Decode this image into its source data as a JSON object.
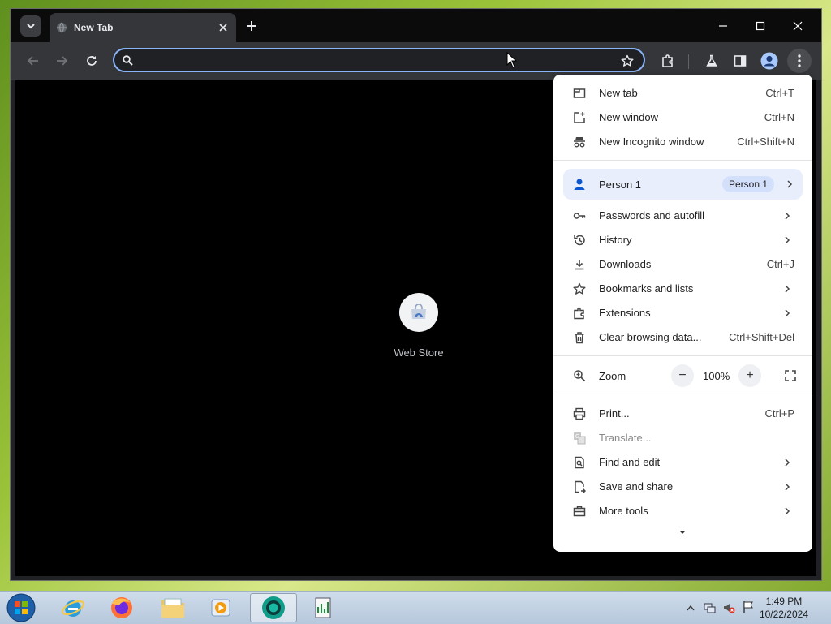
{
  "window": {
    "tab": {
      "title": "New Tab"
    }
  },
  "omnibox": {
    "value": "",
    "placeholder": ""
  },
  "shortcut": {
    "label": "Web Store"
  },
  "menu": {
    "group1": [
      {
        "label": "New tab",
        "shortcut": "Ctrl+T",
        "icon": "new-tab-icon"
      },
      {
        "label": "New window",
        "shortcut": "Ctrl+N",
        "icon": "new-window-icon"
      },
      {
        "label": "New Incognito window",
        "shortcut": "Ctrl+Shift+N",
        "icon": "incognito-icon"
      }
    ],
    "person": {
      "label": "Person 1",
      "badge": "Person 1"
    },
    "group2": [
      {
        "label": "Passwords and autofill",
        "shortcut": "",
        "icon": "key-icon",
        "submenu": true
      },
      {
        "label": "History",
        "shortcut": "",
        "icon": "history-icon",
        "submenu": true
      },
      {
        "label": "Downloads",
        "shortcut": "Ctrl+J",
        "icon": "download-icon",
        "submenu": false
      },
      {
        "label": "Bookmarks and lists",
        "shortcut": "",
        "icon": "star-icon",
        "submenu": true
      },
      {
        "label": "Extensions",
        "shortcut": "",
        "icon": "puzzle-icon",
        "submenu": true
      },
      {
        "label": "Clear browsing data...",
        "shortcut": "Ctrl+Shift+Del",
        "icon": "trash-icon",
        "submenu": false
      }
    ],
    "zoom": {
      "label": "Zoom",
      "value": "100%",
      "minus": "−",
      "plus": "+"
    },
    "group3": [
      {
        "label": "Print...",
        "shortcut": "Ctrl+P",
        "icon": "print-icon",
        "submenu": false,
        "disabled": false
      },
      {
        "label": "Translate...",
        "shortcut": "",
        "icon": "translate-icon",
        "submenu": false,
        "disabled": true
      },
      {
        "label": "Find and edit",
        "shortcut": "",
        "icon": "find-icon",
        "submenu": true,
        "disabled": false
      },
      {
        "label": "Save and share",
        "shortcut": "",
        "icon": "save-share-icon",
        "submenu": true,
        "disabled": false
      },
      {
        "label": "More tools",
        "shortcut": "",
        "icon": "toolbox-icon",
        "submenu": true,
        "disabled": false
      }
    ]
  },
  "taskbar": {
    "clock_time": "1:49 PM",
    "clock_date": "10/22/2024"
  },
  "colors": {
    "accent": "#8ab4f8",
    "toolbar": "#35363a",
    "menu_highlight": "#e8eefc"
  }
}
